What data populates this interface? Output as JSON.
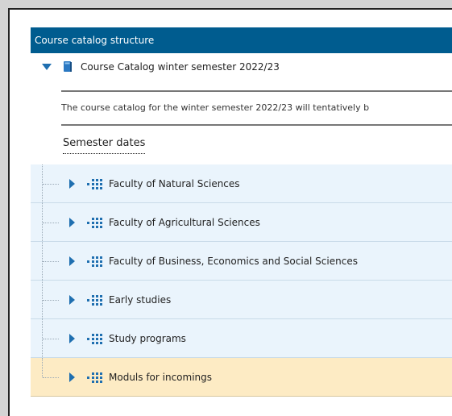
{
  "header": {
    "title": "Course catalog structure"
  },
  "catalog": {
    "title": "Course Catalog winter semester 2022/23",
    "notice": "The course catalog for the winter semester 2022/23 will tentatively b",
    "semester_dates_link": "Semester dates"
  },
  "tree": {
    "nodes": [
      {
        "label": "Faculty of Natural Sciences"
      },
      {
        "label": "Faculty of Agricultural Sciences"
      },
      {
        "label": "Faculty of Business, Economics and Social Sciences"
      },
      {
        "label": "Early studies"
      },
      {
        "label": "Study programs"
      },
      {
        "label": "Moduls for incomings"
      }
    ],
    "selected_index": 5
  },
  "colors": {
    "header_bg": "#005c8f",
    "node_bg": "#eaf4fc",
    "selected_bg": "#fdebc4",
    "accent": "#1f6fb0"
  },
  "icons": {
    "expand_open": "caret-down-icon",
    "expand_closed": "caret-right-icon",
    "catalog": "book-icon",
    "folder": "grid-dots-icon"
  }
}
